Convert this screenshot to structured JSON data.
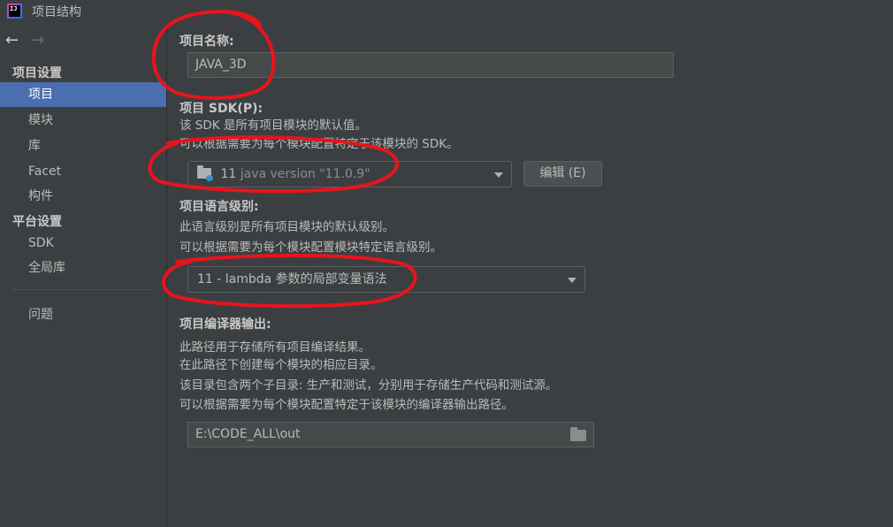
{
  "window": {
    "title": "项目结构",
    "app_icon_text": "IJ"
  },
  "sidebar": {
    "nav": {
      "back": "←",
      "forward": "→"
    },
    "section_project_settings": "项目设置",
    "project_items": [
      {
        "label": "项目",
        "selected": true
      },
      {
        "label": "模块"
      },
      {
        "label": "库"
      },
      {
        "label": "Facet"
      },
      {
        "label": "构件"
      }
    ],
    "section_platform_settings": "平台设置",
    "platform_items": [
      {
        "label": "SDK"
      },
      {
        "label": "全局库"
      }
    ],
    "problems": "问题"
  },
  "main": {
    "project_name": {
      "heading": "项目名称:",
      "value": "JAVA_3D"
    },
    "project_sdk": {
      "heading": "项目 SDK(P):",
      "desc_line1": "该 SDK 是所有项目模块的默认值。",
      "desc_line2": "可以根据需要为每个模块配置特定于该模块的 SDK。",
      "selected_num": "11",
      "selected_version": "java version \"11.0.9\"",
      "edit_button": "编辑 (E)"
    },
    "language_level": {
      "heading": "项目语言级别:",
      "desc_line1": "此语言级别是所有项目模块的默认级别。",
      "desc_line2": "可以根据需要为每个模块配置模块特定语言级别。",
      "selected": "11 - lambda 参数的局部变量语法"
    },
    "compiler_output": {
      "heading": "项目编译器输出:",
      "desc_lines": [
        "此路径用于存储所有项目编译结果。",
        "在此路径下创建每个模块的相应目录。",
        "该目录包含两个子目录: 生产和测试，分别用于存储生产代码和测试源。",
        "可以根据需要为每个模块配置特定于该模块的编译器输出路径。"
      ],
      "path": "E:\\CODE_ALL\\out"
    }
  },
  "colors": {
    "background": "#3c3f41",
    "selection": "#4b6eaf",
    "annotation": "#e8141c"
  }
}
